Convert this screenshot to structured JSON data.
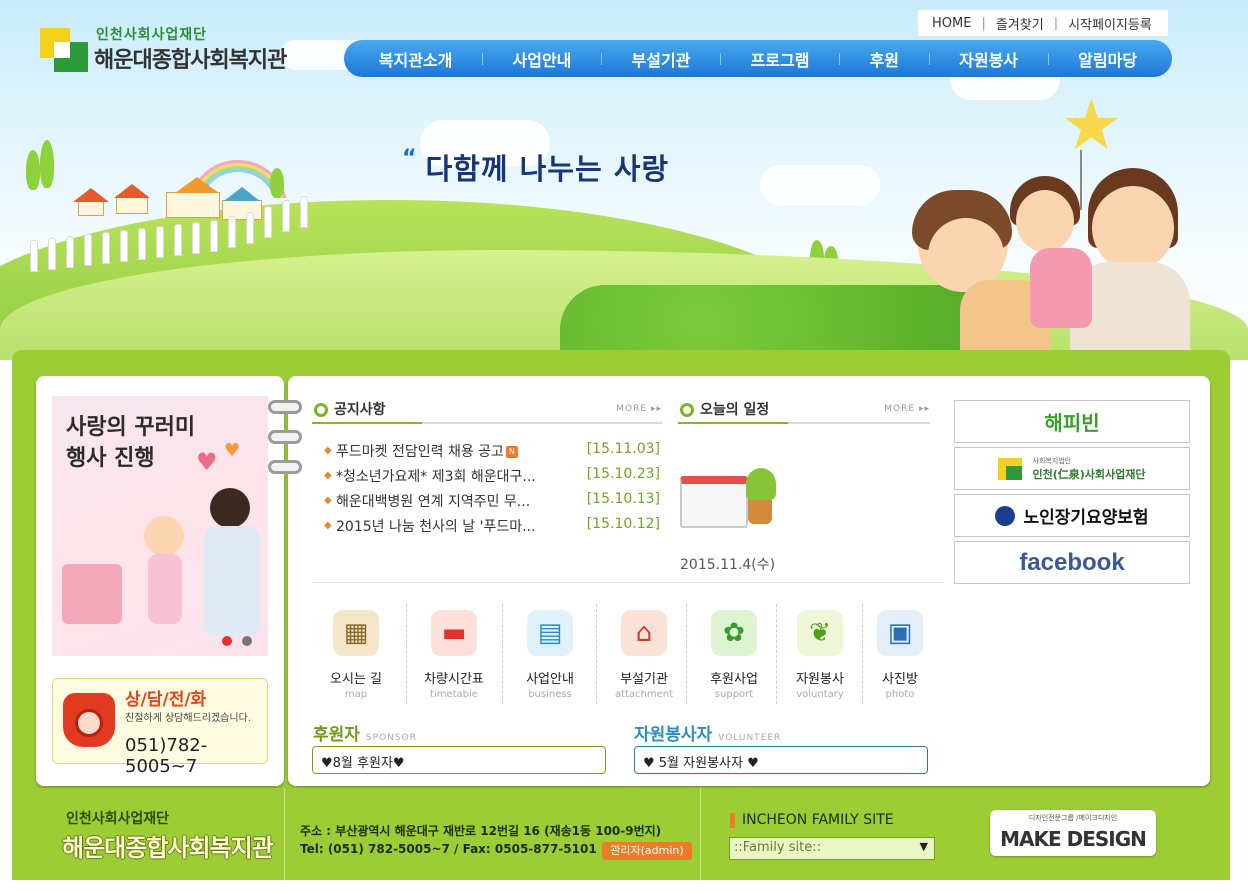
{
  "colors": {
    "nav_blue": "#1d78d6",
    "frame_green": "#9ccd35",
    "date_green": "#6fa61e",
    "accent_orange": "#f07a2a",
    "slogan_navy": "#16357a"
  },
  "header": {
    "logo_sub": "인천사회사업재단",
    "logo_title": "해운대종합사회복지관",
    "top_links": [
      "HOME",
      "즐겨찾기",
      "시작페이지등록"
    ],
    "nav": [
      "복지관소개",
      "사업안내",
      "부설기관",
      "프로그램",
      "후원",
      "자원봉사",
      "알림마당"
    ],
    "slogan": "다함께 나누는 사랑"
  },
  "banner": {
    "title_line1": "사랑의 꾸러미",
    "title_line2": "행사 진행"
  },
  "consult": {
    "title": "상/담/전/화",
    "desc": "친절하게 상담해드리겠습니다.",
    "phone": "051)782-5005~7"
  },
  "notices": {
    "title": "공지사항",
    "more": "MORE",
    "items": [
      {
        "text": "푸드마켓 전담인력 채용 공고",
        "date": "[15.11.03]",
        "new_badge": "N"
      },
      {
        "text": "*청소년가요제* 제3회 해운대구...",
        "date": "[15.10.23]"
      },
      {
        "text": "해운대백병원 연계 지역주민 무...",
        "date": "[15.10.13]"
      },
      {
        "text": "2015년 나눔 천사의 날 '푸드마...",
        "date": "[15.10.12]"
      }
    ]
  },
  "schedule": {
    "title": "오늘의 일정",
    "more": "MORE",
    "date": "2015.11.4(수)"
  },
  "quick_icons": [
    {
      "label": "오시는 길",
      "en": "map",
      "icon": "map-icon"
    },
    {
      "label": "차량시간표",
      "en": "timetable",
      "icon": "car-icon"
    },
    {
      "label": "사업안내",
      "en": "business",
      "icon": "books-icon"
    },
    {
      "label": "부설기관",
      "en": "attachment",
      "icon": "house-icon"
    },
    {
      "label": "후원사업",
      "en": "support",
      "icon": "watering-can-icon"
    },
    {
      "label": "자원봉사",
      "en": "voluntary",
      "icon": "sprout-icon"
    },
    {
      "label": "사진방",
      "en": "photo",
      "icon": "monitor-icon"
    }
  ],
  "sponsor": {
    "title": "후원자",
    "en": "SPONSOR",
    "value": "♥8월 후원자♥"
  },
  "volunteer": {
    "title": "자원봉사자",
    "en": "VOLUNTEER",
    "value": "♥ 5월 자원봉사자 ♥"
  },
  "right_links": {
    "happybean": "해피빈",
    "foundation_sub": "사회복지법인",
    "foundation": "인천(仁泉)사회사업재단",
    "ltc_insurance": "노인장기요양보험",
    "facebook": "facebook"
  },
  "footer": {
    "logo_sub": "인천사회사업재단",
    "logo_title": "해운대종합사회복지관",
    "address": "주소 : 부산광역시 해운대구 재반로 12번길 16 (재송1동 100-9번지)",
    "tel": "Tel: (051) 782-5005~7 / Fax: 0505-877-5101",
    "admin": "관리자(admin)",
    "family_label": "INCHEON FAMILY SITE",
    "family_select": "::Family site::",
    "design_top": "디자인전문그룹 /메이크디자인",
    "design_name": "MAKE DESIGN"
  }
}
